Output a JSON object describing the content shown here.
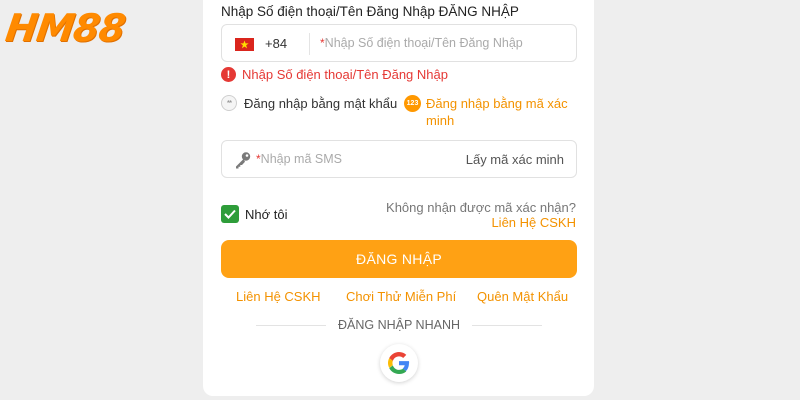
{
  "brand": {
    "logo_text": "HM88",
    "color": "#ff8a00"
  },
  "form": {
    "phone_label": "Nhập Số điện thoại/Tên Đăng Nhập ĐĂNG NHẬP",
    "country_code": "+84",
    "country_flag_icon": "vietnam-flag-icon",
    "required_mark": "*",
    "phone_placeholder": "Nhập Số điện thoại/Tên Đăng Nhập",
    "error_icon": "!",
    "error_text": "Nhập Số điện thoại/Tên Đăng Nhập",
    "login_by_password": "Đăng nhập bằng mật khẩu",
    "password_icon_text": "**",
    "login_by_code": "Đăng nhập bằng mã xác minh",
    "code_icon_text": "123",
    "sms_placeholder": "Nhập mã SMS",
    "get_code": "Lấy mã xác minh",
    "remember_me": "Nhớ tôi",
    "remember_checked": true,
    "no_code_text": "Không nhận được mã xác nhận?",
    "contact_link": "Liên Hệ CSKH",
    "login_button": "ĐĂNG NHẬP"
  },
  "footer_links": {
    "contact": "Liên Hệ CSKH",
    "free_play": "Chơi Thử Miễn Phí",
    "forgot_password": "Quên Mật Khẩu"
  },
  "quick_login": {
    "label": "ĐĂNG NHẬP NHANH",
    "provider_icon": "google-icon"
  },
  "colors": {
    "accent": "#ffa114",
    "error": "#e53935",
    "success": "#2e9d3a",
    "link": "#f39200"
  }
}
